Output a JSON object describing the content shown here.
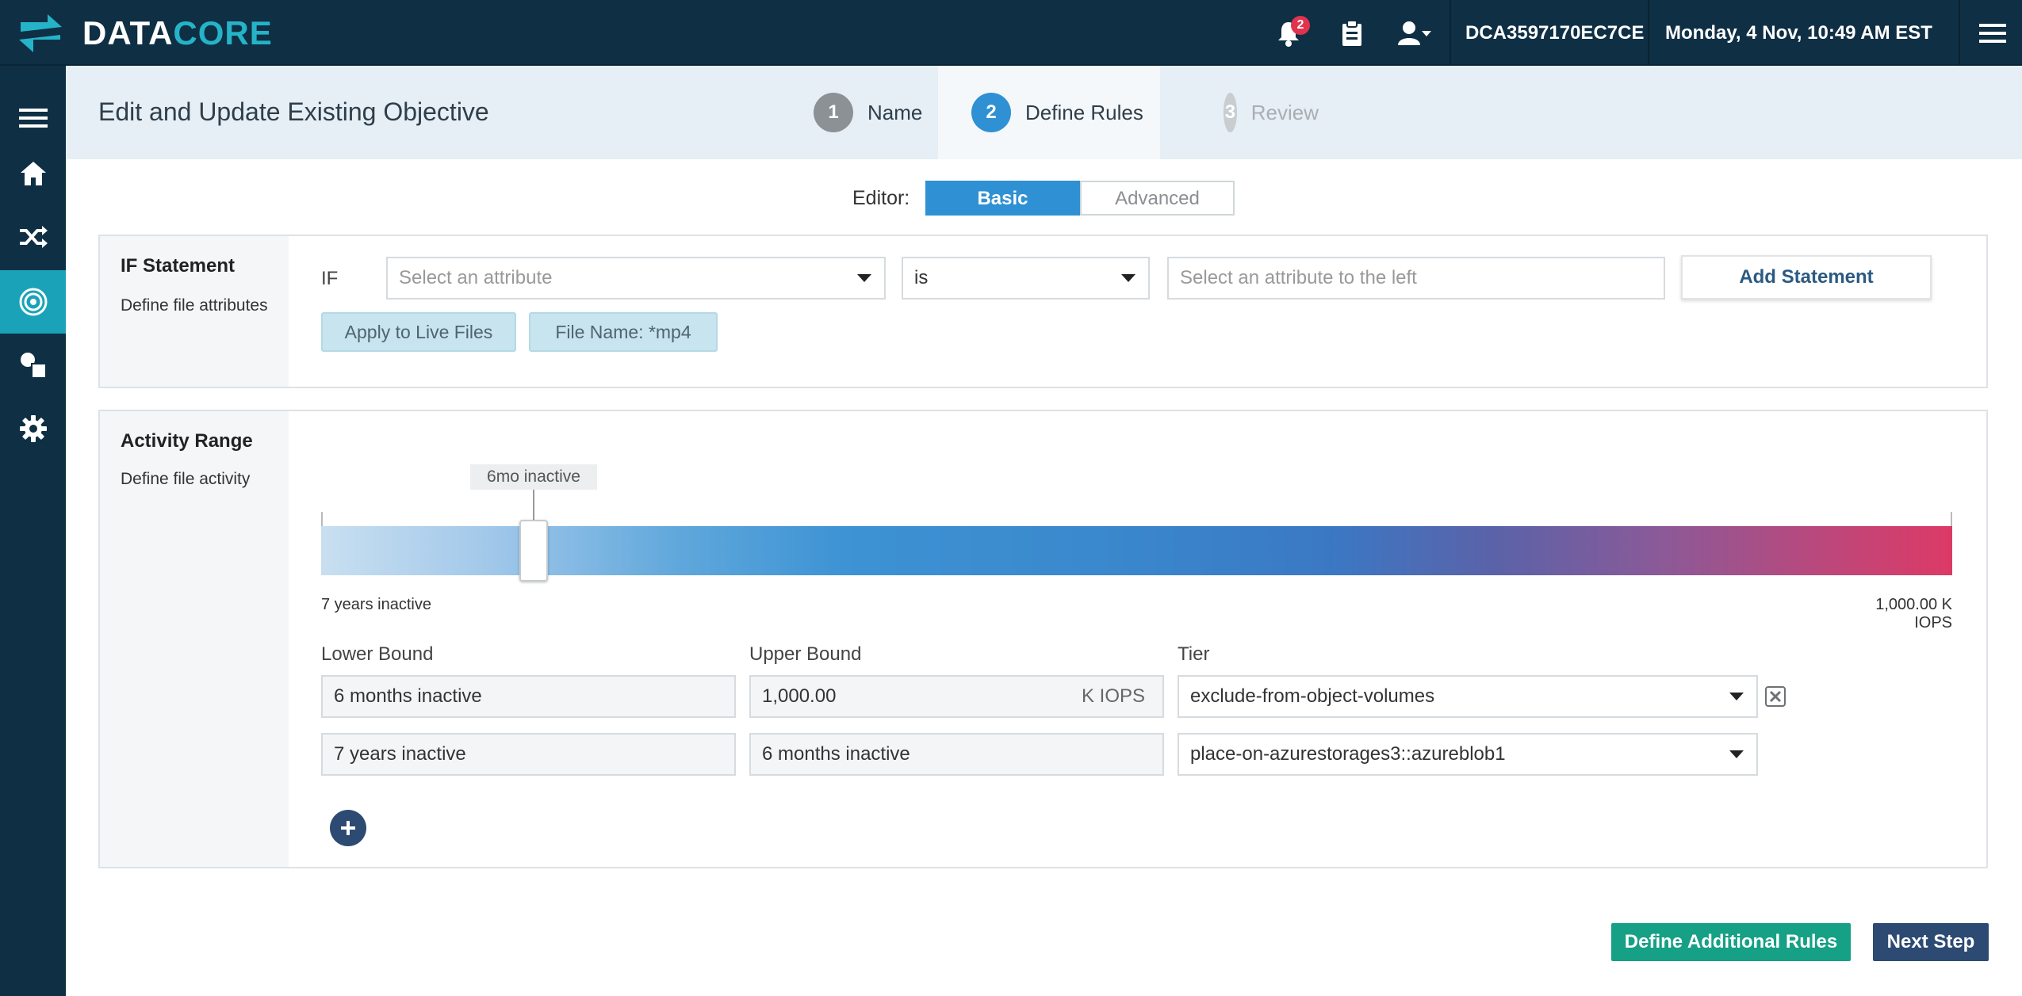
{
  "brand": {
    "name_main": "DATA",
    "name_accent": "CORE"
  },
  "header": {
    "notifications_count": "2",
    "host_id": "DCA3597170EC7CE",
    "datetime": "Monday, 4 Nov, 10:49 AM EST"
  },
  "nav": {
    "items": [
      {
        "icon": "hamburger-icon",
        "active": false
      },
      {
        "icon": "home-icon",
        "active": false
      },
      {
        "icon": "shuffle-icon",
        "active": false
      },
      {
        "icon": "target-icon",
        "active": true
      },
      {
        "icon": "shapes-icon",
        "active": false
      },
      {
        "icon": "gear-icon",
        "active": false
      }
    ]
  },
  "page": {
    "title": "Edit and Update Existing Objective"
  },
  "steps": [
    {
      "number": "1",
      "label": "Name",
      "state": "done"
    },
    {
      "number": "2",
      "label": "Define Rules",
      "state": "active"
    },
    {
      "number": "3",
      "label": "Review",
      "state": "pending"
    }
  ],
  "editor": {
    "label": "Editor:",
    "basic": "Basic",
    "advanced": "Advanced",
    "selected": "Basic"
  },
  "if_statement": {
    "title": "IF Statement",
    "description": "Define file attributes",
    "if_label": "IF",
    "attribute_placeholder": "Select an attribute",
    "operator_value": "is",
    "value_placeholder": "Select an attribute to the left",
    "add_button": "Add Statement",
    "chips": [
      "Apply to Live Files",
      "File Name: *mp4"
    ]
  },
  "activity_range": {
    "title": "Activity Range",
    "description": "Define file activity",
    "slider_tooltip": "6mo inactive",
    "slider_position_fraction": 0.13,
    "min_label": "7 years inactive",
    "max_label": "1,000.00 K IOPS",
    "columns": {
      "lower": "Lower Bound",
      "upper": "Upper Bound",
      "tier": "Tier"
    },
    "rows": [
      {
        "lower": "6 months inactive",
        "upper": "1,000.00",
        "upper_unit": "K IOPS",
        "tier": "exclude-from-object-volumes",
        "deletable": true
      },
      {
        "lower": "7 years inactive",
        "upper": "6 months inactive",
        "upper_unit": "",
        "tier": "place-on-azurestorages3::azureblob1",
        "deletable": false
      }
    ]
  },
  "footer": {
    "define_additional": "Define Additional Rules",
    "next_step": "Next Step"
  },
  "colors": {
    "topbar": "#0f2f44",
    "accent": "#1aa3b8",
    "primary": "#2f91d3",
    "green": "#16a085",
    "navy": "#2d4a73"
  }
}
